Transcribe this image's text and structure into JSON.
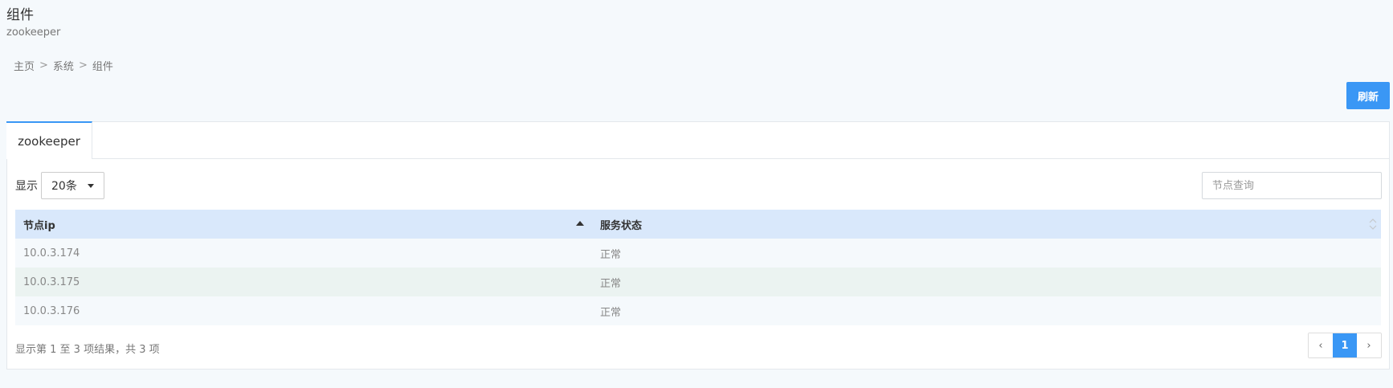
{
  "header": {
    "title": "组件",
    "subtitle": "zookeeper"
  },
  "breadcrumb": {
    "items": [
      "主页",
      "系统",
      "组件"
    ],
    "separator": ">"
  },
  "toolbar": {
    "refresh_label": "刷新"
  },
  "tabs": [
    {
      "label": "zookeeper",
      "active": true
    }
  ],
  "controls": {
    "show_label": "显示",
    "page_size": "20条",
    "search_placeholder": "节点查询"
  },
  "table": {
    "columns": [
      "节点ip",
      "服务状态"
    ],
    "sort": {
      "column": "节点ip",
      "direction": "ascending"
    },
    "rows": [
      {
        "ip": "10.0.3.174",
        "status": "正常"
      },
      {
        "ip": "10.0.3.175",
        "status": "正常"
      },
      {
        "ip": "10.0.3.176",
        "status": "正常"
      }
    ]
  },
  "footer": {
    "info": "显示第 1 至 3 项结果，共 3 项",
    "pagination": {
      "prev_icon": "chevron-left-icon",
      "current_page": "1",
      "next_icon": "chevron-right-icon"
    }
  },
  "colors": {
    "accent": "#3a97f5",
    "status_ok": "#1aa35a",
    "table_header": "#d9e8fb"
  }
}
